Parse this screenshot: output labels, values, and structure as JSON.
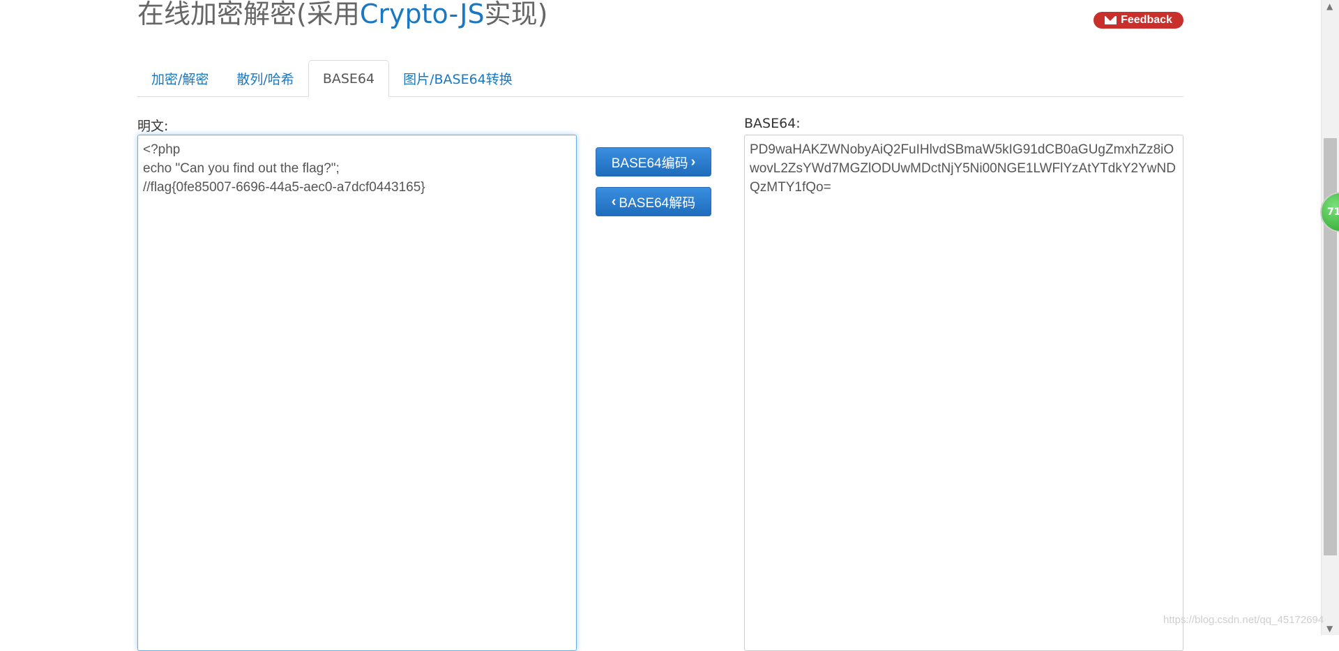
{
  "header": {
    "title_prefix": "在线加密解密(采用",
    "title_accent": "Crypto-JS",
    "title_suffix": "实现)",
    "feedback_label": "Feedback"
  },
  "tabs": [
    {
      "label": "加密/解密",
      "active": false
    },
    {
      "label": "散列/哈希",
      "active": false
    },
    {
      "label": "BASE64",
      "active": true
    },
    {
      "label": "图片/BASE64转换",
      "active": false
    }
  ],
  "plaintext": {
    "label": "明文:",
    "value": "<?php\necho \"Can you find out the flag?\";\n//flag{0fe85007-6696-44a5-aec0-a7dcf0443165}"
  },
  "base64": {
    "label": "BASE64:",
    "value": "PD9waHAKZWNobyAiQ2FuIHlvdSBmaW5kIG91dCB0aGUgZmxhZz8iOwovL2ZsYWd7MGZlODUwMDctNjY5Ni00NGE1LWFlYzAtYTdkY2YwNDQzMTY1fQo="
  },
  "buttons": {
    "encode_label": "BASE64编码",
    "decode_label": "BASE64解码"
  },
  "badge_text": "71",
  "watermark": "https://blog.csdn.net/qq_45172694",
  "colors": {
    "accent": "#1a78c2",
    "feedback": "#c9302c",
    "button": "#1f6cbc"
  }
}
